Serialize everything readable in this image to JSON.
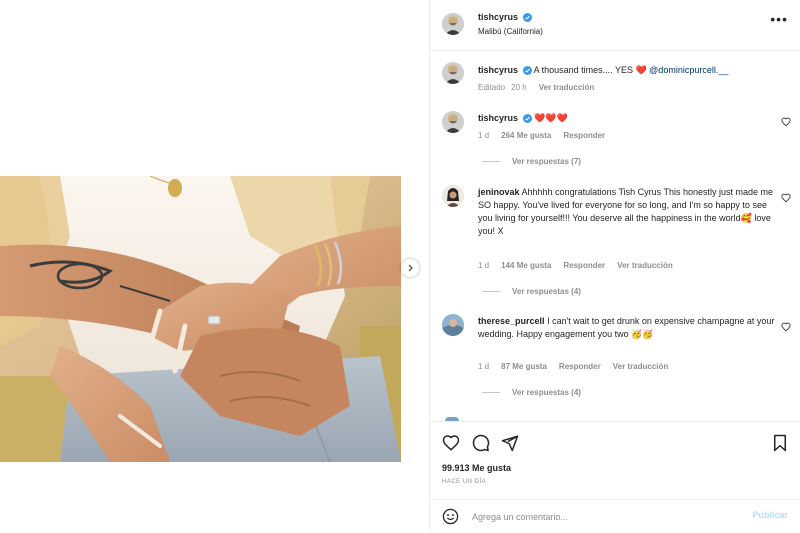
{
  "post": {
    "username": "tishcyrus",
    "location": "Malibú (California)",
    "more_label": "•••",
    "caption": {
      "username": "tishcyrus",
      "text": "A thousand times.... YES ❤️ ",
      "mention": "@dominicpurcell.__",
      "edited": "Editado",
      "time": "20 h",
      "translate": "Ver traducción"
    },
    "likes": "99.913 Me gusta",
    "date": "HACE UN DÍA"
  },
  "comments": [
    {
      "username": "tishcyrus",
      "text": "❤️❤️❤️",
      "time": "1 d",
      "likes": "264 Me gusta",
      "reply": "Responder",
      "translate": "",
      "view_replies": "Ver respuestas (7)"
    },
    {
      "username": "jeninovak",
      "text": "Ahhhhh congratulations Tish Cyrus This honestly just made me SO happy. You've lived for everyone for so long, and I'm so happy to see you living for yourself!!! You deserve all the happiness in the world🥰 love you! X",
      "time": "1 d",
      "likes": "144 Me gusta",
      "reply": "Responder",
      "translate": "Ver traducción",
      "view_replies": "Ver respuestas (4)"
    },
    {
      "username": "therese_purcell",
      "text": "I can't wait to get drunk on expensive champagne at your wedding. Happy engagement you two 🥳🥳",
      "time": "1 d",
      "likes": "87 Me gusta",
      "reply": "Responder",
      "translate": "Ver traducción",
      "view_replies": "Ver respuestas (4)"
    }
  ],
  "add_comment": {
    "placeholder": "Agrega un comentario...",
    "publish": "Publicar"
  },
  "icons": {
    "like": "heart-icon",
    "comment": "comment-icon",
    "share": "send-icon",
    "save": "bookmark-icon",
    "emoji": "smiley-icon",
    "verified": "verified-badge-icon",
    "next": "chevron-right-icon"
  },
  "colors": {
    "text": "#262626",
    "secondary": "#8e8e8e",
    "verified": "#3897f0",
    "publish": "#b2dffc",
    "mention": "#00376b",
    "heart": "#ed4956"
  }
}
